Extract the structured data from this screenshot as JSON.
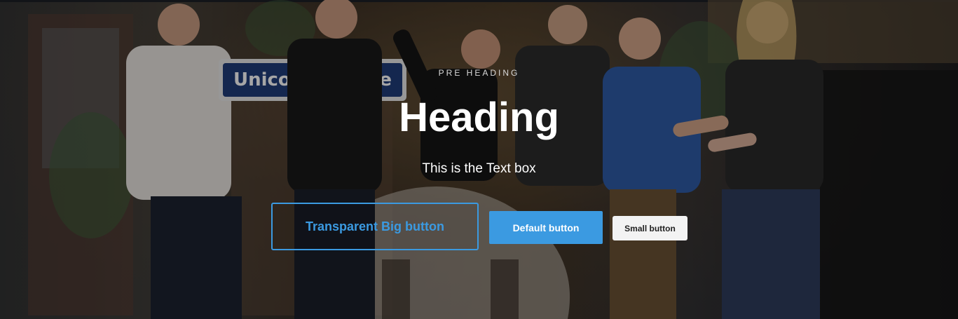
{
  "hero": {
    "pre_heading": "PRE HEADING",
    "heading": "Heading",
    "text": "This is the Text box",
    "sign_text": "Unicorn Square"
  },
  "buttons": {
    "transparent_big": "Transparent Big button",
    "default": "Default button",
    "small": "Small button"
  },
  "colors": {
    "accent": "#3b9ae1",
    "small_button_bg": "#f3f3f3"
  }
}
